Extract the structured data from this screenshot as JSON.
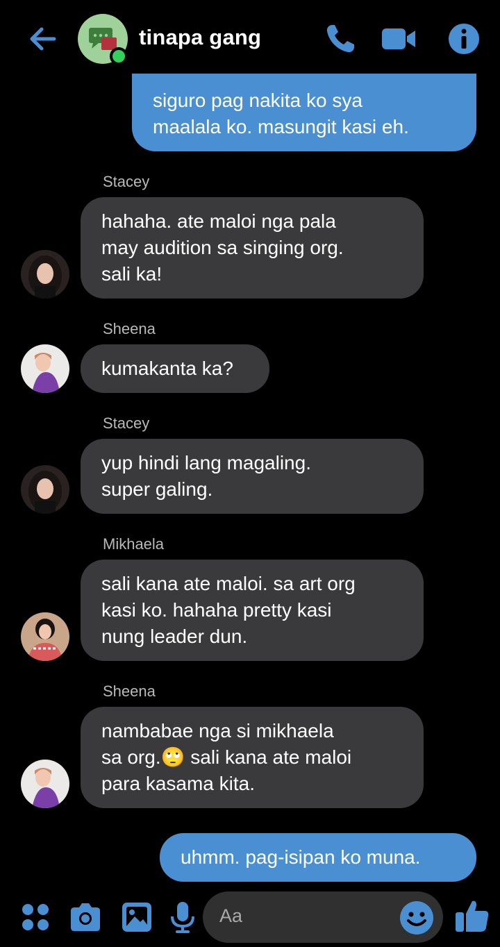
{
  "colors": {
    "accent": "#4b8fd3",
    "incoming": "#3a3a3c",
    "online": "#35d05b"
  },
  "header": {
    "title": "tinapa gang",
    "icons": [
      "back-arrow-icon",
      "group-chat-avatar",
      "phone-icon",
      "video-camera-icon",
      "info-icon"
    ]
  },
  "messages": [
    {
      "direction": "out",
      "lines": [
        "siguro pag nakita ko sya",
        "maalala ko. masungit kasi eh."
      ]
    },
    {
      "direction": "in",
      "sender": "Stacey",
      "lines": [
        "hahaha. ate maloi nga pala",
        "may audition sa singing org.",
        "sali ka!"
      ]
    },
    {
      "direction": "in",
      "sender": "Sheena",
      "lines": [
        "kumakanta ka?"
      ]
    },
    {
      "direction": "in",
      "sender": "Stacey",
      "lines": [
        "yup hindi lang magaling.",
        "super galing."
      ]
    },
    {
      "direction": "in",
      "sender": "Mikhaela",
      "lines": [
        "sali kana ate maloi. sa art org",
        "kasi ko. hahaha pretty kasi",
        "nung leader dun."
      ]
    },
    {
      "direction": "in",
      "sender": "Sheena",
      "lines": [
        "nambabae nga si mikhaela",
        "sa org.🙄 sali kana ate maloi",
        "para kasama kita."
      ]
    },
    {
      "direction": "out",
      "lines": [
        "uhmm. pag-isipan ko muna."
      ]
    }
  ],
  "composer": {
    "placeholder": "Aa",
    "icons": [
      "apps-grid-icon",
      "camera-icon",
      "gallery-icon",
      "microphone-icon",
      "emoji-icon",
      "thumbs-up-icon"
    ]
  }
}
